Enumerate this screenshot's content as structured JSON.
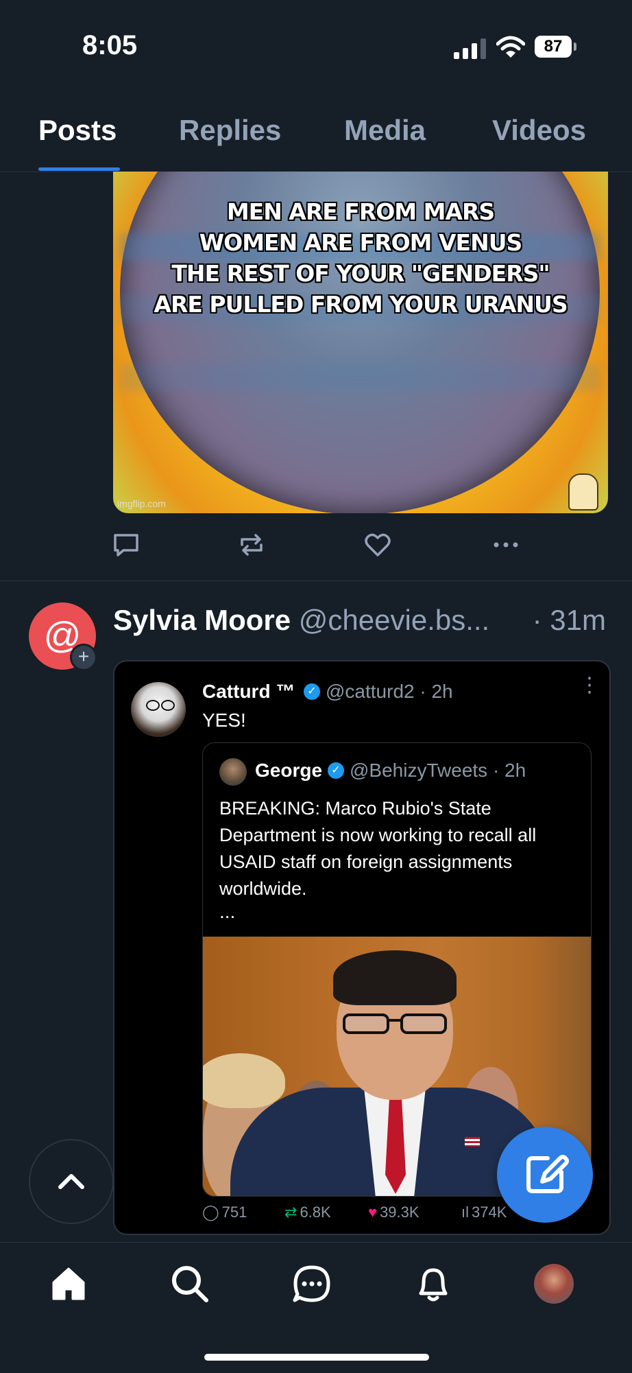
{
  "status": {
    "time": "8:05",
    "battery": "87"
  },
  "tabs": [
    {
      "label": "Posts",
      "active": true
    },
    {
      "label": "Replies",
      "active": false
    },
    {
      "label": "Media",
      "active": false
    },
    {
      "label": "Videos",
      "active": false
    }
  ],
  "meme": {
    "lines": [
      "MEN ARE FROM MARS",
      "WOMEN ARE FROM VENUS",
      "THE REST OF YOUR \"GENDERS\"",
      "ARE PULLED FROM YOUR URANUS"
    ],
    "watermark": "imgflip.com"
  },
  "post2": {
    "author_name": "Sylvia Moore",
    "author_handle": "@cheevie.bs...",
    "time": "· 31m",
    "avatar_glyph": "@",
    "avatar_badge": "+",
    "embed": {
      "name": "Catturd ™",
      "handle": "@catturd2 · 2h",
      "text": "YES!",
      "quote": {
        "name": "George",
        "handle": "@BehizyTweets · 2h",
        "body": "BREAKING: Marco Rubio's State Department is now working to recall all USAID staff on foreign assignments worldwide.",
        "more": "..."
      },
      "stats": {
        "replies": "751",
        "reposts": "6.8K",
        "likes": "39.3K",
        "views": "374K"
      }
    }
  },
  "colors": {
    "accent": "#2f7fe6",
    "background": "#161e27",
    "avatar": "#ea4f53",
    "like": "#f91880",
    "repost": "#00ba7c"
  },
  "icons": {
    "actions": [
      "comment-icon",
      "repost-icon",
      "like-icon",
      "more-icon"
    ],
    "nav": [
      "home-icon",
      "search-icon",
      "chat-icon",
      "bell-icon",
      "profile-avatar"
    ]
  }
}
